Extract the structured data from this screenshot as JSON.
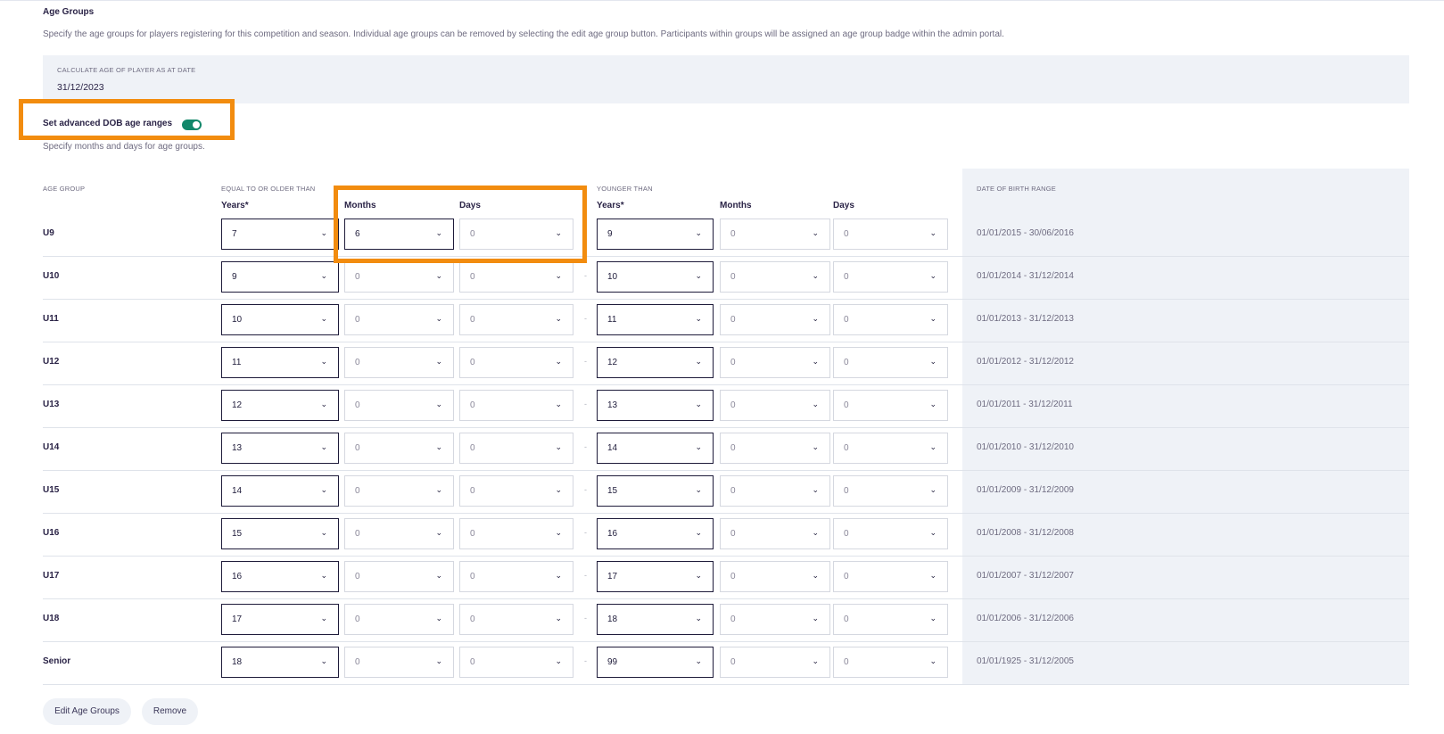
{
  "section": {
    "title": "Age Groups",
    "description": "Specify the age groups for players registering for this competition and season. Individual age groups can be removed by selecting the edit age group button. Participants within groups will be assigned an age group badge within the admin portal."
  },
  "calculate": {
    "label": "CALCULATE AGE OF PLAYER AS AT DATE",
    "value": "31/12/2023"
  },
  "advanced": {
    "label": "Set advanced DOB age ranges",
    "enabled": true,
    "description": "Specify months and days for age groups."
  },
  "columns": {
    "age_group": "AGE GROUP",
    "older_than": "EQUAL TO OR OLDER THAN",
    "younger_than": "YOUNGER THAN",
    "dob_range": "DATE OF BIRTH RANGE",
    "years": "Years*",
    "months": "Months",
    "days": "Days"
  },
  "rows": [
    {
      "group": "U9",
      "from_years": "7",
      "from_months": "6",
      "from_days": "0",
      "to_years": "9",
      "to_months": "0",
      "to_days": "0",
      "dob": "01/01/2015 - 30/06/2016"
    },
    {
      "group": "U10",
      "from_years": "9",
      "from_months": "0",
      "from_days": "0",
      "to_years": "10",
      "to_months": "0",
      "to_days": "0",
      "dob": "01/01/2014 - 31/12/2014"
    },
    {
      "group": "U11",
      "from_years": "10",
      "from_months": "0",
      "from_days": "0",
      "to_years": "11",
      "to_months": "0",
      "to_days": "0",
      "dob": "01/01/2013 - 31/12/2013"
    },
    {
      "group": "U12",
      "from_years": "11",
      "from_months": "0",
      "from_days": "0",
      "to_years": "12",
      "to_months": "0",
      "to_days": "0",
      "dob": "01/01/2012 - 31/12/2012"
    },
    {
      "group": "U13",
      "from_years": "12",
      "from_months": "0",
      "from_days": "0",
      "to_years": "13",
      "to_months": "0",
      "to_days": "0",
      "dob": "01/01/2011 - 31/12/2011"
    },
    {
      "group": "U14",
      "from_years": "13",
      "from_months": "0",
      "from_days": "0",
      "to_years": "14",
      "to_months": "0",
      "to_days": "0",
      "dob": "01/01/2010 - 31/12/2010"
    },
    {
      "group": "U15",
      "from_years": "14",
      "from_months": "0",
      "from_days": "0",
      "to_years": "15",
      "to_months": "0",
      "to_days": "0",
      "dob": "01/01/2009 - 31/12/2009"
    },
    {
      "group": "U16",
      "from_years": "15",
      "from_months": "0",
      "from_days": "0",
      "to_years": "16",
      "to_months": "0",
      "to_days": "0",
      "dob": "01/01/2008 - 31/12/2008"
    },
    {
      "group": "U17",
      "from_years": "16",
      "from_months": "0",
      "from_days": "0",
      "to_years": "17",
      "to_months": "0",
      "to_days": "0",
      "dob": "01/01/2007 - 31/12/2007"
    },
    {
      "group": "U18",
      "from_years": "17",
      "from_months": "0",
      "from_days": "0",
      "to_years": "18",
      "to_months": "0",
      "to_days": "0",
      "dob": "01/01/2006 - 31/12/2006"
    },
    {
      "group": "Senior",
      "from_years": "18",
      "from_months": "0",
      "from_days": "0",
      "to_years": "99",
      "to_months": "0",
      "to_days": "0",
      "dob": "01/01/1925 - 31/12/2005"
    }
  ],
  "separator": "-",
  "buttons": {
    "edit": "Edit Age Groups",
    "remove": "Remove"
  },
  "colors": {
    "toggle_on": "#12876a",
    "highlight": "#f28c0f",
    "panel": "#eff2f7"
  }
}
